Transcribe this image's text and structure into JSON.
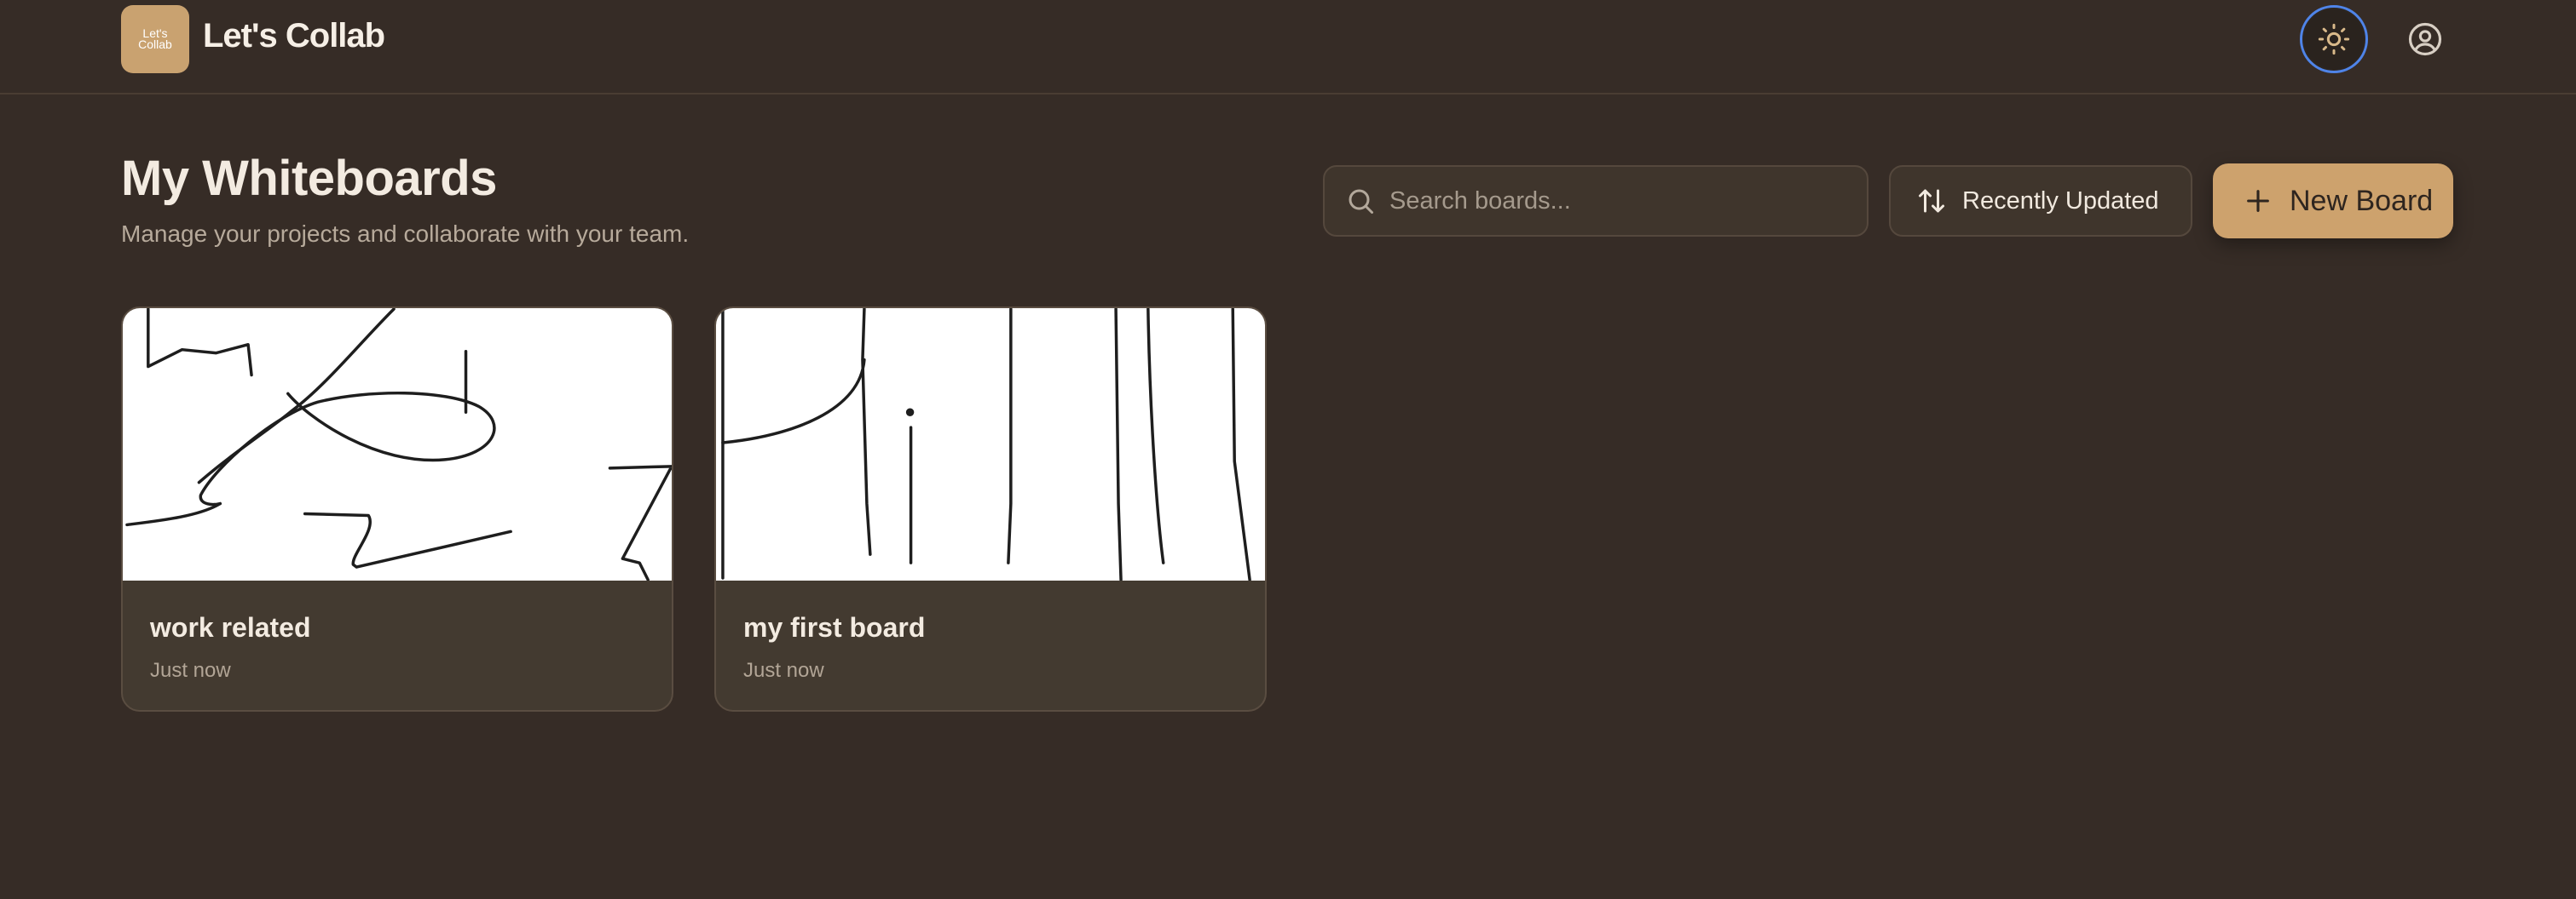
{
  "header": {
    "logo_text_line1": "Let's",
    "logo_text_line2": "Collab",
    "app_title": "Let's Collab"
  },
  "main": {
    "title": "My Whiteboards",
    "subtitle": "Manage your projects and collaborate with your team.",
    "search": {
      "placeholder": "Search boards..."
    },
    "sort_label": "Recently Updated",
    "new_board_label": "New Board"
  },
  "boards": [
    {
      "name": "work related",
      "updated": "Just now"
    },
    {
      "name": "my first board",
      "updated": "Just now"
    }
  ],
  "colors": {
    "background": "#362c26",
    "accent": "#cda26d",
    "card": "#433a30",
    "focus_ring": "#4f84e8"
  },
  "icons": {
    "theme": "sun-icon",
    "user": "user-circle-icon",
    "search": "search-icon",
    "sort": "sort-arrows-icon",
    "add": "plus-icon"
  }
}
